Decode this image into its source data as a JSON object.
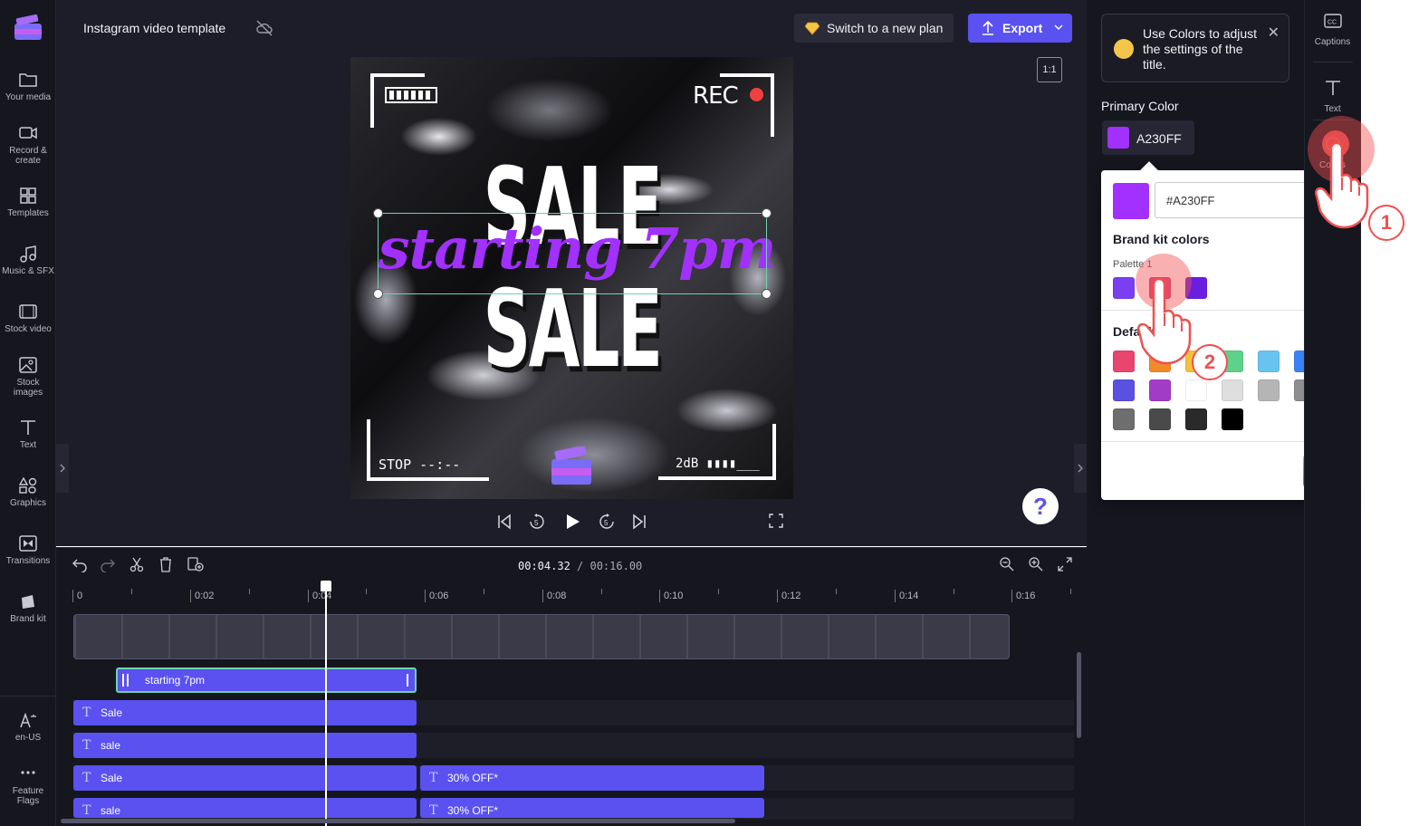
{
  "left_nav": {
    "items": [
      {
        "label": "Your media",
        "icon": "folder-icon"
      },
      {
        "label": "Record & create",
        "icon": "camera-icon"
      },
      {
        "label": "Templates",
        "icon": "templates-icon"
      },
      {
        "label": "Music & SFX",
        "icon": "music-icon"
      },
      {
        "label": "Stock video",
        "icon": "film-icon"
      },
      {
        "label": "Stock images",
        "icon": "image-icon"
      },
      {
        "label": "Text",
        "icon": "text-icon"
      },
      {
        "label": "Graphics",
        "icon": "shapes-icon"
      },
      {
        "label": "Transitions",
        "icon": "transitions-icon"
      },
      {
        "label": "Brand kit",
        "icon": "brand-kit-icon"
      }
    ],
    "bottom_items": [
      {
        "label": "en-US",
        "icon": "language-icon"
      },
      {
        "label": "Feature Flags",
        "icon": "more-icon"
      }
    ]
  },
  "header": {
    "project_title": "Instagram video template",
    "plan_button": "Switch to a new plan",
    "export_button": "Export"
  },
  "preview": {
    "aspect_ratio": "1:1",
    "rec_label": "REC",
    "headline_top": "SALE",
    "headline_bottom": "SALE",
    "script_text": "starting 7pm",
    "stop_label": "STOP --:--",
    "db_label": "2dB ▮▮▮▮___",
    "help_label": "?"
  },
  "timeline": {
    "current_time": "00:04.32",
    "total_time": "/ 00:16.00",
    "ruler": [
      "0",
      "0:02",
      "0:04",
      "0:06",
      "0:08",
      "0:10",
      "0:12",
      "0:14",
      "0:16"
    ],
    "clips": [
      {
        "label": "starting 7pm",
        "row": 0
      },
      {
        "label": "Sale",
        "row": 1
      },
      {
        "label": "sale",
        "row": 2
      },
      {
        "label": "Sale",
        "row": 3
      },
      {
        "label": "30% OFF*",
        "row": 3
      },
      {
        "label": "sale",
        "row": 4
      },
      {
        "label": "30% OFF*",
        "row": 4
      }
    ]
  },
  "tip": {
    "text": "Use Colors to adjust the settings of the title."
  },
  "primary_color": {
    "label": "Primary Color",
    "hex_display": "A230FF",
    "value": "#A230FF"
  },
  "picker": {
    "hex_input": "#A230FF",
    "brand_heading": "Brand kit colors",
    "palette_label": "Palette 1",
    "palette": [
      "#7a3ff0",
      "#e0457a",
      "#6a1fe0"
    ],
    "default_heading": "Default",
    "defaults": [
      "#e8456f",
      "#f08a2a",
      "#f3c23b",
      "#5ed28a",
      "#68c3ef",
      "#3b82f6",
      "#5a51e0",
      "#a23cc7",
      "#ffffff",
      "#dedede",
      "#b5b5b5",
      "#8e8e8e",
      "#6e6e6e",
      "#4a4a4a",
      "#2a2a2a",
      "#000000"
    ]
  },
  "right_rail": {
    "items": [
      {
        "label": "Captions",
        "icon": "captions-icon"
      },
      {
        "label": "Text",
        "icon": "text-icon"
      },
      {
        "label": "Colors",
        "icon": "palette-icon"
      }
    ]
  },
  "annotations": {
    "step_1": "1",
    "step_2": "2"
  }
}
